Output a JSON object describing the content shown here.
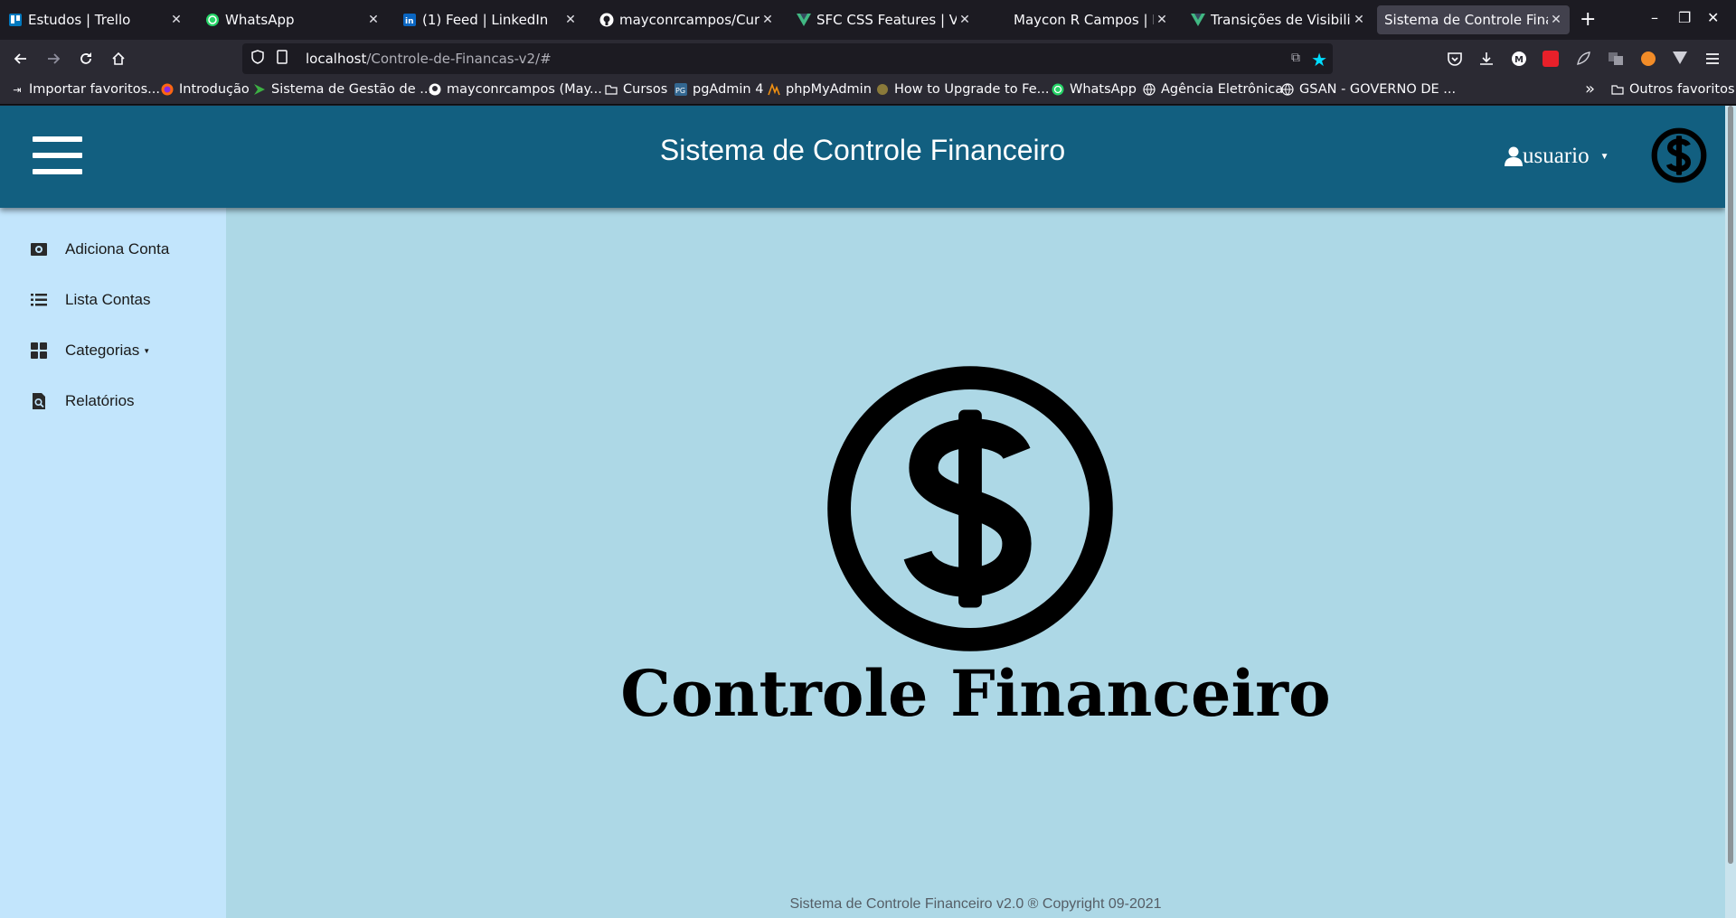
{
  "browser": {
    "tabs": [
      {
        "title": "Estudos | Trello",
        "icon": "trello-icon",
        "color": "#0079bf"
      },
      {
        "title": "WhatsApp",
        "icon": "whatsapp-icon",
        "color": "#25d366"
      },
      {
        "title": "(1) Feed | LinkedIn",
        "icon": "linkedin-icon",
        "color": "#0a66c2"
      },
      {
        "title": "mayconrcampos/Curriculo",
        "icon": "github-icon",
        "color": "#ffffff"
      },
      {
        "title": "SFC CSS Features | Vue.js",
        "icon": "vue-icon",
        "color": "#41b883"
      },
      {
        "title": "Maycon R Campos | DEV Full",
        "icon": "none",
        "color": "#ffffff"
      },
      {
        "title": "Transições de Visibilidade",
        "icon": "vue-icon",
        "color": "#41b883"
      },
      {
        "title": "Sistema de Controle Financeiro",
        "icon": "none",
        "color": "#ffffff"
      }
    ],
    "new_tab": "+",
    "window_controls": {
      "minimize": "–",
      "restore": "❐",
      "close": "✕"
    },
    "url_host": "localhost",
    "url_path": "/Controle-de-Financas-v2/#",
    "bookmarks": [
      {
        "label": "Importar favoritos...",
        "icon": "import-icon"
      },
      {
        "label": "Introdução",
        "icon": "firefox-icon"
      },
      {
        "label": "Sistema de Gestão de ...",
        "icon": "arrow-logo-icon"
      },
      {
        "label": "mayconrcampos (May...",
        "icon": "github-icon"
      },
      {
        "label": "Cursos",
        "icon": "folder-icon"
      },
      {
        "label": "pgAdmin 4",
        "icon": "pgadmin-icon"
      },
      {
        "label": "phpMyAdmin",
        "icon": "phpmyadmin-icon"
      },
      {
        "label": "How to Upgrade to Fe...",
        "icon": "fedora-icon"
      },
      {
        "label": "WhatsApp",
        "icon": "whatsapp-icon"
      },
      {
        "label": "Agência Eletrônica",
        "icon": "globe-icon"
      },
      {
        "label": "GSAN - GOVERNO DE ...",
        "icon": "globe-icon"
      }
    ],
    "bookmarks_overflow": "»",
    "other_bookmarks": "Outros favoritos"
  },
  "app": {
    "title": "Sistema de Controle Financeiro",
    "user": "usuario",
    "menu": [
      {
        "label": "Adiciona Conta",
        "icon": "money-bill-icon"
      },
      {
        "label": "Lista Contas",
        "icon": "list-icon"
      },
      {
        "label": "Categorias",
        "icon": "grid-icon",
        "dropdown": true
      },
      {
        "label": "Relatórios",
        "icon": "file-search-icon"
      }
    ],
    "brand": "Controle Financeiro",
    "footer": "Sistema de Controle Financeiro v2.0 ® Copyright 09-2021",
    "colors": {
      "header": "#125f80",
      "sidebar": "#c2e5fc",
      "main": "#add8e6"
    }
  }
}
